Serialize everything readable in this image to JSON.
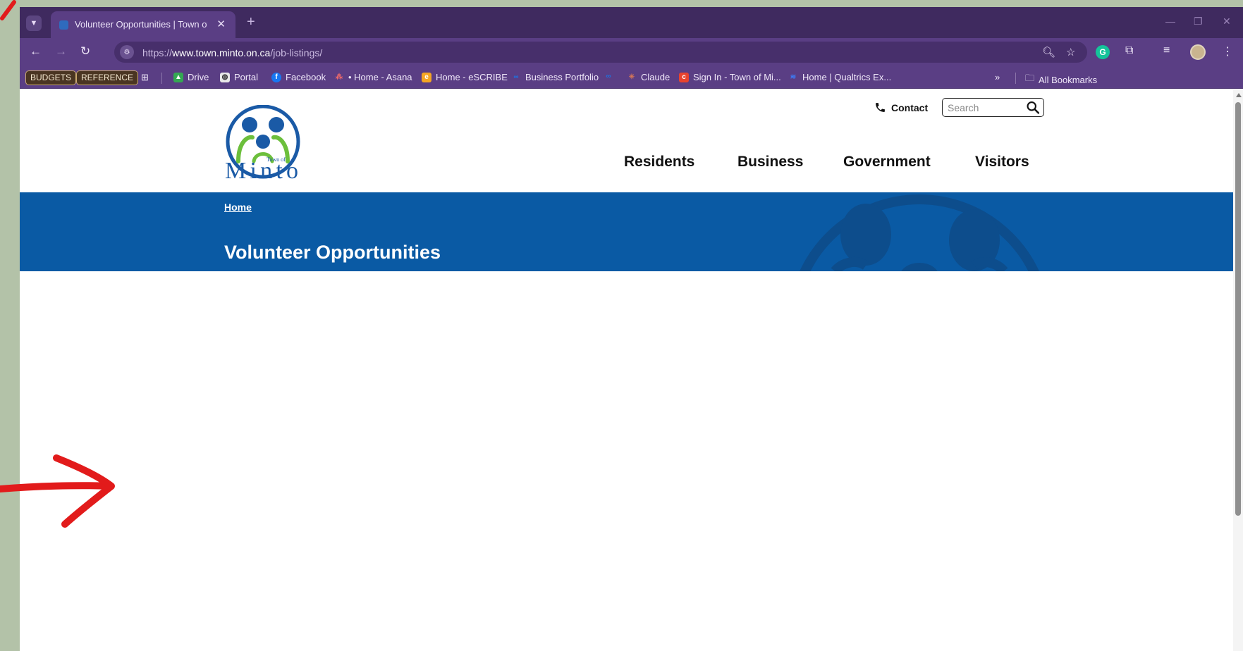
{
  "browser": {
    "tab": {
      "title": "Volunteer Opportunities | Town of Minto"
    },
    "address": {
      "scheme": "https://",
      "host": "www.town.minto.on.ca",
      "path": "/job-listings/"
    },
    "bookmarks": {
      "pills": [
        "BUDGETS",
        "REFERENCE"
      ],
      "items": [
        {
          "label": "Drive",
          "color": "#34a853"
        },
        {
          "label": "Portal",
          "color": "#ffffff"
        },
        {
          "label": "Facebook",
          "color": "#1877f2"
        },
        {
          "label": "• Home - Asana",
          "color": "#f06a6a"
        },
        {
          "label": "Home - eSCRIBE",
          "color": "#f5a623"
        },
        {
          "label": "Business Portfolio",
          "color": "#1b74e4"
        },
        {
          "label": "Claude",
          "color": "#d97757"
        },
        {
          "label": "Sign In - Town of Mi...",
          "color": "#e8432e"
        },
        {
          "label": "Home | Qualtrics Ex...",
          "color": "#3d7bf5"
        }
      ],
      "overflow": "»",
      "all_bookmarks": "All Bookmarks"
    }
  },
  "site": {
    "logo": {
      "line1": "Town of",
      "line2": "Minto"
    },
    "contact": "Contact",
    "search": {
      "placeholder": "Search",
      "value": ""
    },
    "nav": [
      "Residents",
      "Business",
      "Government",
      "Visitors"
    ],
    "breadcrumb": "Home",
    "title": "Volunteer Opportunities"
  },
  "colors": {
    "chrome": "#5a3e84",
    "tabstrip": "#3f2a5f",
    "banner": "#0a5aa4",
    "logo_blue": "#1a5aa6",
    "logo_green": "#6cbf3c",
    "annotation": "#e21b1b",
    "backdrop": "#b3c2a8"
  }
}
